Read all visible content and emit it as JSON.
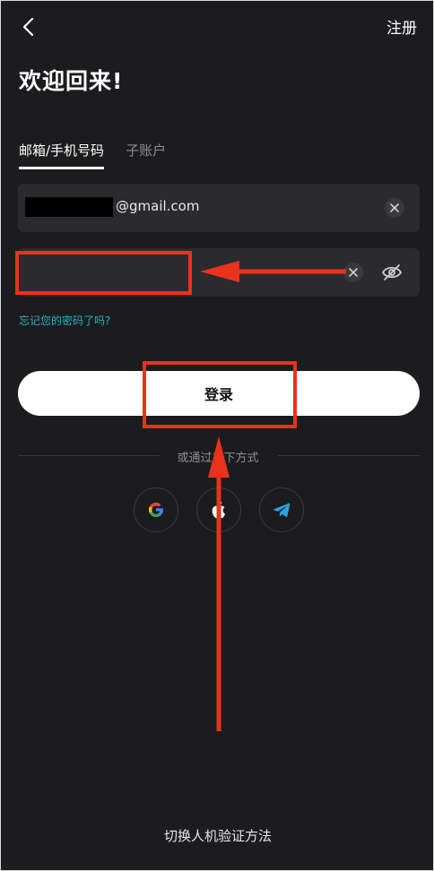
{
  "header": {
    "back_icon": "chevron-left-icon",
    "register_label": "注册"
  },
  "title": "欢迎回来!",
  "tabs": [
    {
      "label": "邮箱/手机号码",
      "active": true
    },
    {
      "label": "子账户",
      "active": false
    }
  ],
  "email": {
    "value_suffix": "@gmail.com",
    "clear_icon": "close-icon"
  },
  "password": {
    "clear_icon": "close-icon",
    "visibility_icon": "eye-off-icon"
  },
  "forgot_link": "忘记您的密码了吗?",
  "login_button": "登录",
  "divider_text": "或通过以下方式",
  "social": [
    {
      "name": "google",
      "icon": "google-icon"
    },
    {
      "name": "apple",
      "icon": "apple-icon"
    },
    {
      "name": "telegram",
      "icon": "telegram-icon"
    }
  ],
  "switch_verification": "切换人机验证方法",
  "colors": {
    "background": "#1c1c1e",
    "field": "#2b2b2e",
    "link": "#27b0c7",
    "annotation": "#e8321c",
    "button": "#ffffff"
  }
}
